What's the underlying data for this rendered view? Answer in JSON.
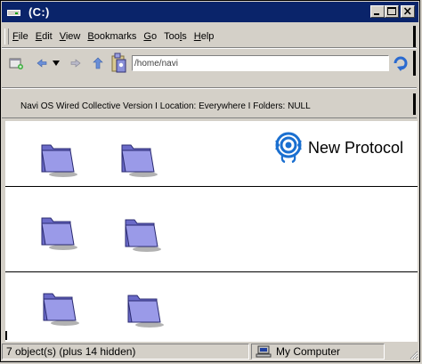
{
  "window": {
    "title": "(C:)",
    "buttons": {
      "minimize": "minimize-icon",
      "maximize": "maximize-icon",
      "close": "close-icon"
    }
  },
  "menu": {
    "items": [
      {
        "accel": "F",
        "rest": "ile"
      },
      {
        "accel": "E",
        "rest": "dit"
      },
      {
        "accel": "V",
        "rest": "iew"
      },
      {
        "accel": "B",
        "rest": "ookmarks"
      },
      {
        "accel": "G",
        "rest": "o"
      },
      {
        "accel": "",
        "rest": "Too",
        "accel2": "l",
        "rest2": "s"
      },
      {
        "accel": "H",
        "rest": "elp"
      }
    ]
  },
  "toolbar": {
    "address_value": "/home/navi"
  },
  "infobar": {
    "text": "Navi OS Wired Collective Version I Location: Everywhere I Folders: NULL"
  },
  "brand": {
    "text": "New Protocol",
    "color": "#1a6fd0"
  },
  "status": {
    "objects": "7 object(s) (plus 14 hidden)",
    "location": "My Computer"
  },
  "colors": {
    "titlebar": "#0a246a",
    "folder": "#9a9ae8",
    "window_bg": "#d4d0c8"
  }
}
